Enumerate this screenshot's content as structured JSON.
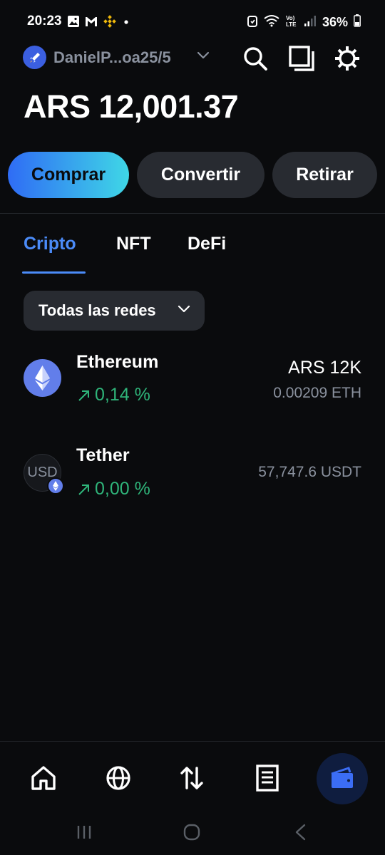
{
  "status_bar": {
    "time": "20:23",
    "battery": "36%",
    "icons": [
      "image-icon",
      "gmail-icon",
      "binance-icon",
      "dot-icon",
      "alarm-icon",
      "wifi-icon",
      "volte-icon",
      "signal-icon",
      "battery-icon"
    ]
  },
  "header": {
    "account_name": "DanielP...oa25/5",
    "icons": [
      "search-icon",
      "copy-icon",
      "gear-icon"
    ]
  },
  "balance": "ARS 12,001.37",
  "actions": {
    "buy": "Comprar",
    "convert": "Convertir",
    "withdraw": "Retirar"
  },
  "tabs": [
    {
      "label": "Cripto",
      "active": true
    },
    {
      "label": "NFT",
      "active": false
    },
    {
      "label": "DeFi",
      "active": false
    }
  ],
  "filter": {
    "label": "Todas las redes"
  },
  "assets": [
    {
      "name": "Ethereum",
      "change": "0,14 %",
      "fiat_value": "ARS 12K",
      "crypto_amount": "0.00209 ETH",
      "icon": "ethereum-icon"
    },
    {
      "name": "Tether",
      "change": "0,00 %",
      "fiat_value": "",
      "crypto_amount": "57,747.6 USDT",
      "icon_text": "USD",
      "icon": "tether-icon"
    }
  ],
  "bottom_nav": [
    "home-icon",
    "browser-icon",
    "transfer-icon",
    "activity-icon",
    "wallet-icon"
  ],
  "colors": {
    "background": "#0a0b0d",
    "accent": "#4b8bf7",
    "positive": "#2fb57a",
    "muted": "#8a919e",
    "button": "#282b31"
  }
}
